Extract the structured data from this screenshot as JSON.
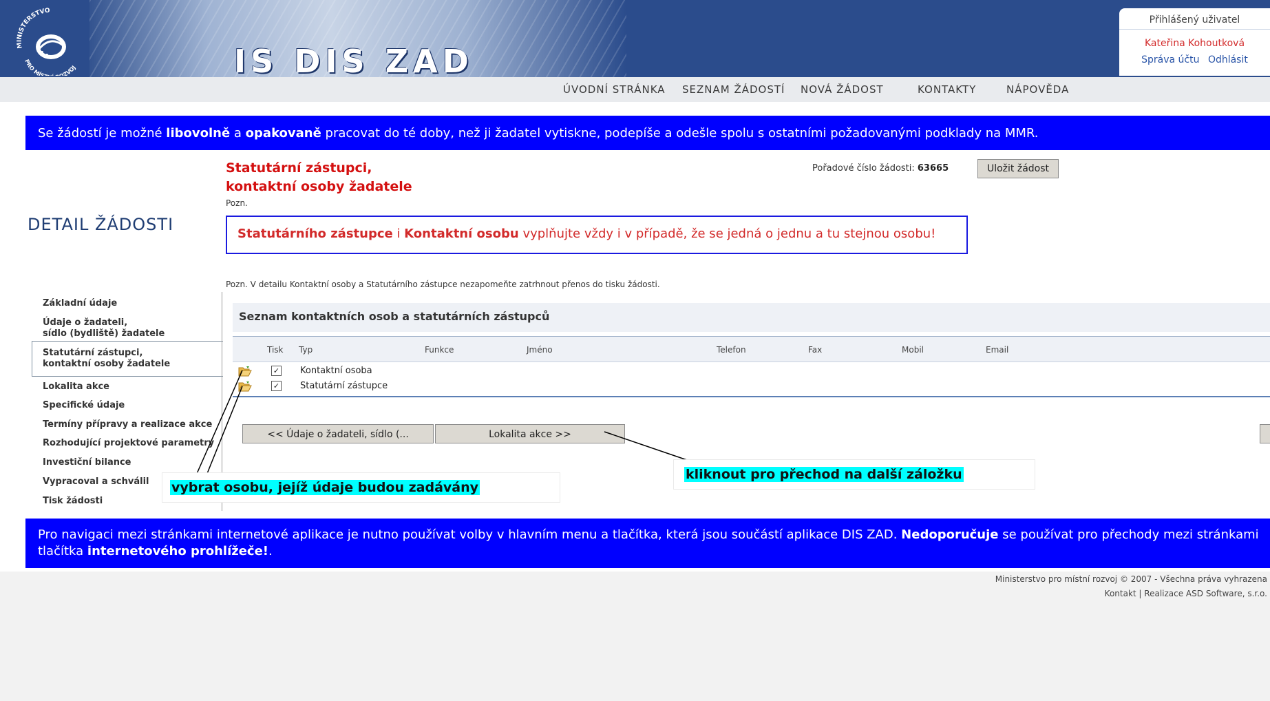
{
  "header": {
    "logo_text_top": "MINISTERSTVO",
    "logo_text_bottom": "PRO MÍSTNÍ ROZVOJ",
    "app_title": "IS DIS ZAD",
    "user_box_title": "Přihlášený uživatel",
    "user_name": "Kateřina Kohoutková",
    "account_link": "Správa účtu",
    "logout_link": "Odhlásit"
  },
  "menu": {
    "items": [
      "ÚVODNÍ STRÁNKA",
      "SEZNAM ŽÁDOSTÍ",
      "NOVÁ ŽÁDOST",
      "KONTAKTY",
      "NÁPOVĚDA"
    ]
  },
  "info_banner": {
    "t1": "Se žádostí je možné ",
    "b1": "libovolně",
    "t2": " a ",
    "b2": "opakovaně",
    "t3": " pracovat do té doby, než ji žadatel vytiskne, podepíše a odešle spolu s ostatními požadovanými podklady na MMR."
  },
  "detail_title": "DETAIL ŽÁDOSTI",
  "section": {
    "title_line1": "Statutární zástupci,",
    "title_line2": "kontaktní osoby žadatele",
    "pozn": "Pozn.",
    "order_label": "Pořadové číslo žádosti: ",
    "order_number": "63665",
    "save_button": "Uložit žádost"
  },
  "warning": {
    "b1": "Statutárního zástupce",
    "t1": " i ",
    "b2": "Kontaktní osobu",
    "t2": " vyplňujte vždy i v případě, že se jedná o jednu a tu stejnou osobu!"
  },
  "note_below": "Pozn. V detailu Kontaktní osoby a Statutárního zástupce nezapomeňte zatrhnout přenos do tisku žádosti.",
  "sidebar": {
    "items": [
      "Základní údaje",
      "Údaje o žadateli,",
      "sídlo (bydliště) žadatele",
      "Statutární zástupci,",
      "kontaktní osoby žadatele",
      "Lokalita akce",
      "Specifické údaje",
      "Termíny přípravy a realizace akce",
      "Rozhodující projektové parametry",
      "Investiční bilance",
      "Vypracoval a schválil",
      "Tisk žádosti"
    ]
  },
  "list": {
    "title": "Seznam kontaktních osob a statutárních zástupců",
    "columns": [
      "Tisk",
      "Typ",
      "Funkce",
      "Jméno",
      "Telefon",
      "Fax",
      "Mobil",
      "Email"
    ],
    "rows": [
      {
        "print": "✓",
        "type": "Kontaktní osoba"
      },
      {
        "print": "✓",
        "type": "Statutární zástupce"
      }
    ]
  },
  "nav": {
    "prev_button": "<< Údaje o žadateli, sídlo (...",
    "next_button": "Lokalita akce >>"
  },
  "annotations": {
    "select_person": "vybrat osobu, jejíž údaje budou zadávány",
    "next_tab": "kliknout pro přechod na další záložku"
  },
  "bottom_banner": {
    "t1": "Pro navigaci mezi stránkami internetové aplikace je nutno používat volby v hlavním menu a tlačítka, která jsou součástí aplikace DIS ZAD. ",
    "b1": "Nedoporučuje",
    "t2": " se používat pro přechody mezi stránkami tlačítka ",
    "b2": "internetového prohlížeče!",
    "t3": "."
  },
  "footer": {
    "copyright": "Ministerstvo pro místní rozvoj © 2007 - Všechna práva vyhrazena",
    "contact": "Kontakt",
    "separator": " | ",
    "realization": "Realizace ASD Software, s.r.o."
  },
  "colors": {
    "header_blue": "#2b4c8c",
    "banner_blue": "#0000ff",
    "accent_red": "#d41010",
    "highlight_cyan": "#00ffff"
  }
}
